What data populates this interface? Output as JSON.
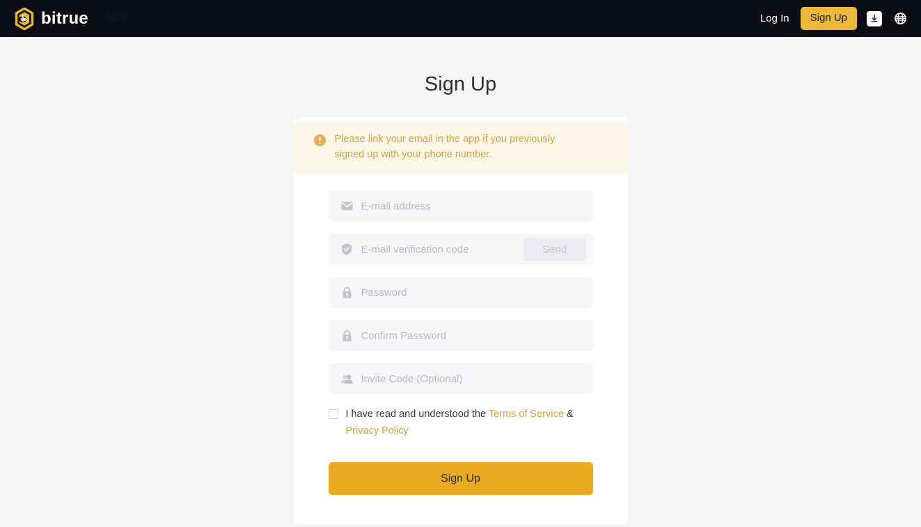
{
  "header": {
    "logo_text": "bitrue",
    "logo_icon": "bitrue-hexagon-logo",
    "debug_text": "false",
    "login_label": "Log In",
    "signup_label": "Sign Up",
    "download_icon": "download-icon",
    "language_icon": "globe-icon",
    "background_color": "#0b0e14",
    "accent_color": "#eab93c"
  },
  "page": {
    "title": "Sign Up",
    "background_color": "#f5f5f5"
  },
  "alert": {
    "icon": "exclamation-circle-icon",
    "message": "Please link your email in the app if you previously signed up with your phone number.",
    "text_color": "#d3a14a",
    "background_color": "#fcf6e6"
  },
  "form": {
    "fields": [
      {
        "name": "email",
        "icon": "envelope-icon",
        "placeholder": "E-mail address",
        "value": ""
      },
      {
        "name": "verification_code",
        "icon": "shield-check-icon",
        "placeholder": "E-mail verification code",
        "value": ""
      },
      {
        "name": "password",
        "icon": "lock-icon",
        "placeholder": "Password",
        "value": ""
      },
      {
        "name": "confirm_password",
        "icon": "lock-icon",
        "placeholder": "Confirm Password",
        "value": ""
      },
      {
        "name": "invite_code",
        "icon": "users-icon",
        "placeholder": "Invite Code (Optional)",
        "value": ""
      }
    ],
    "send_label": "Send",
    "terms": {
      "checked": false,
      "prefix": "I have read and understood the ",
      "terms_link": "Terms of Service",
      "separator": " & ",
      "privacy_link": "Privacy Policy",
      "link_color": "#d6a23f"
    },
    "submit_label": "Sign Up",
    "submit_color": "#e8ab22"
  }
}
